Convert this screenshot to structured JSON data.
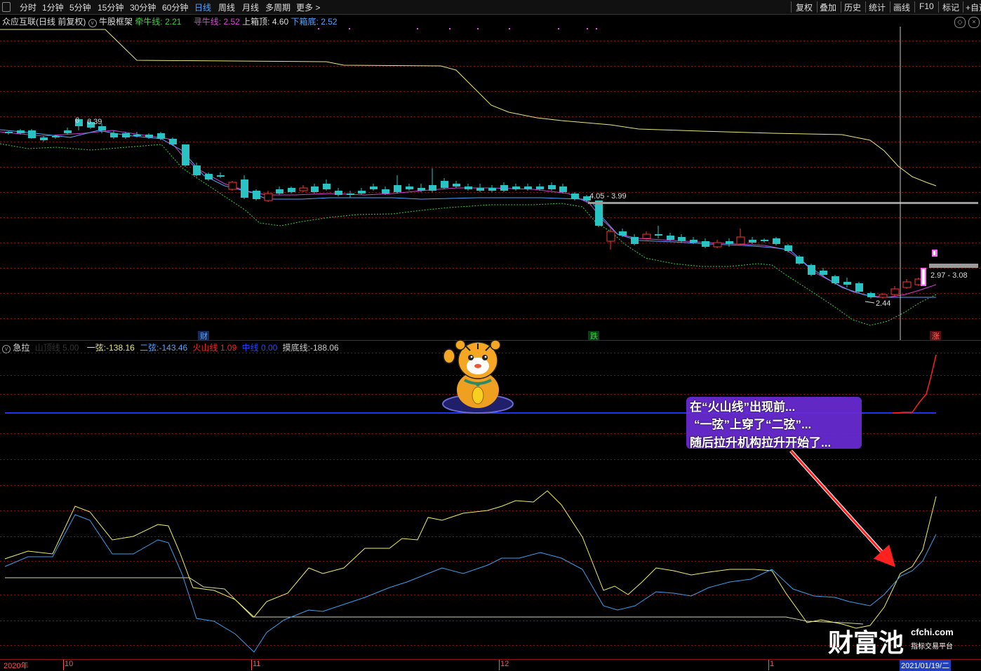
{
  "toolbar": {
    "left_items": [
      "分时",
      "1分钟",
      "5分钟",
      "15分钟",
      "30分钟",
      "60分钟",
      "日线",
      "周线",
      "月线",
      "多周期",
      "更多 >"
    ],
    "active": "日线",
    "right_items": [
      "复权",
      "叠加",
      "历史",
      "统计",
      "画线",
      "F10",
      "标记",
      "+自选"
    ]
  },
  "main_header": {
    "stock": "众应互联(日线 前复权)",
    "formula": "牛股框架",
    "l1_label": "牵牛线:",
    "l1_value": "2.21",
    "l2_label": "寻牛线:",
    "l2_value": "2.52",
    "l3_label": "上箱顶:",
    "l3_value": "4.60",
    "l4_label": "下箱底:",
    "l4_value": "2.52"
  },
  "main_annotations": {
    "high_label": "6.39",
    "high_tick": "6",
    "range1": "4.05 - 3.99",
    "range2": "2.97 - 3.08",
    "low_label": "2.44",
    "marker_cai": "财",
    "marker_die": "跌",
    "marker_zhang": "涨"
  },
  "ind_header": {
    "name": "急拉",
    "param_label": "山顶线",
    "param_value": "5.00",
    "yx_label": "一弦:",
    "yx_value": "-138.16",
    "ex_label": "二弦:",
    "ex_value": "-143.46",
    "hs_label": "火山线",
    "hs_value": "1.09",
    "zx_label": "中线",
    "zx_value": "0.00",
    "md_label": "摸底线:",
    "md_value": "-188.06"
  },
  "annotation": {
    "line1": "在“火山线”出现前...",
    "line2": "“一弦”上穿了“二弦”...",
    "line3": "随后拉升机构拉升开始了..."
  },
  "watermark": {
    "brand": "财富池",
    "site": "cfchi.com",
    "tagline": "指标交易平台"
  },
  "xaxis": {
    "labels": [
      "2020年",
      "10",
      "11",
      "12",
      "1"
    ],
    "cursor_date": "2021/01/19/二"
  },
  "colors": {
    "up": "#ff3333",
    "down": "#29c3c3",
    "yellow_line": "#e8e87a",
    "blue_line": "#4da6ff",
    "magenta_line": "#d63dd6",
    "green_dotted": "#3bd13b",
    "grid": "#8a1010",
    "annotation_bg": "#6a2bd6",
    "volcano": "#ff2020"
  }
}
